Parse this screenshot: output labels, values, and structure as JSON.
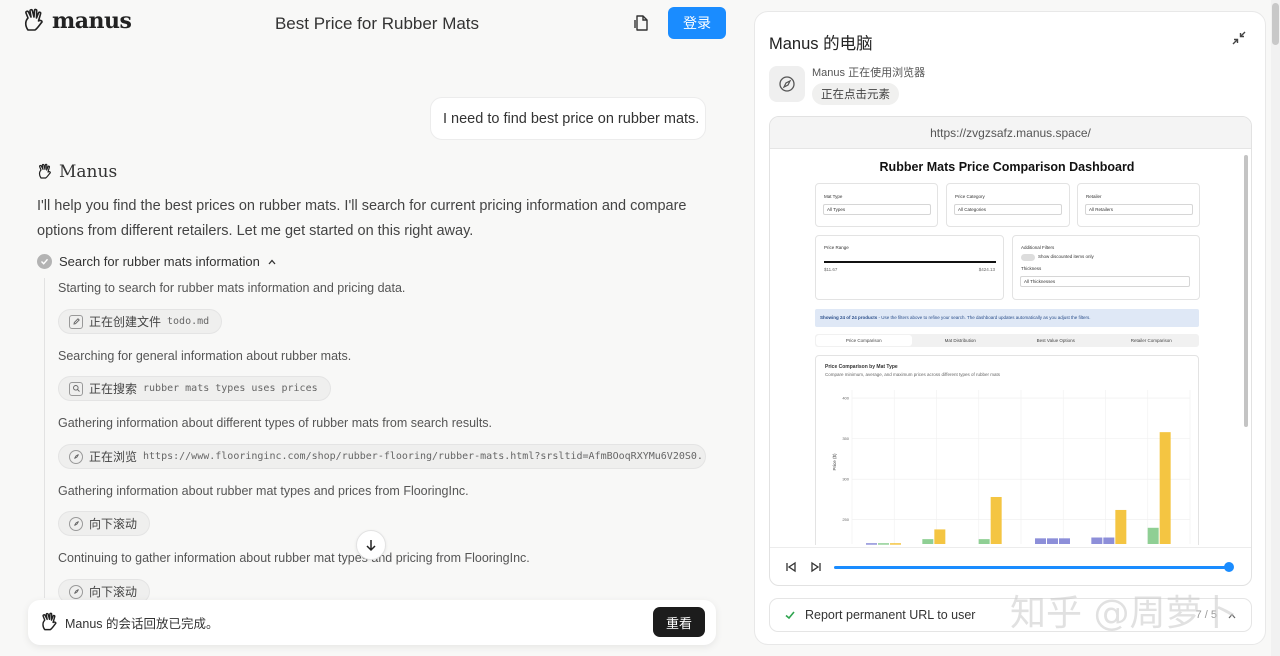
{
  "header": {
    "brand": "manus",
    "title": "Best Price for Rubber Mats",
    "login_label": "登录"
  },
  "chat": {
    "user_message": "I need to find best price on rubber mats.",
    "agent_name": "Manus",
    "agent_message": "I'll help you find the best prices on rubber mats. I'll search for current pricing information and compare options from different retailers. Let me get started on this right away.",
    "step_title": "Search for rubber mats information",
    "steps": [
      {
        "text": "Starting to search for rubber mats information and pricing data.",
        "action": "正在创建文件",
        "arg": "todo.md",
        "icon": "edit-icon"
      },
      {
        "text": "Searching for general information about rubber mats.",
        "action": "正在搜索",
        "arg": "rubber mats types uses prices",
        "icon": "search-icon"
      },
      {
        "text": "Gathering information about different types of rubber mats from search results.",
        "action": "正在浏览",
        "arg": "https://www.flooringinc.com/shop/rubber-flooring/rubber-mats.html?srsltid=AfmBOoqRXYMu6V20S0...",
        "icon": "compass-icon"
      },
      {
        "text": "Gathering information about rubber mat types and prices from FlooringInc.",
        "action": "向下滚动",
        "arg": "",
        "icon": "compass-icon"
      },
      {
        "text": "Continuing to gather information about rubber mat types and pricing from FlooringInc.",
        "action": "向下滚动",
        "arg": "",
        "icon": "compass-icon"
      }
    ],
    "completion_text": "Manus 的会话回放已完成。",
    "replay_label": "重看"
  },
  "computer": {
    "title": "Manus 的电脑",
    "using_text": "Manus 正在使用浏览器",
    "action": "正在点击元素",
    "url": "https://zvgzsafz.manus.space/",
    "status_text": "Report permanent URL to user",
    "counter": "7 / 5"
  },
  "dashboard": {
    "title": "Rubber Mats Price Comparison Dashboard",
    "filters": [
      {
        "label": "Mat Type",
        "value": "All Types"
      },
      {
        "label": "Price Category",
        "value": "All Categories"
      },
      {
        "label": "Retailer",
        "value": "All Retailers"
      }
    ],
    "price_range_label": "Price Range",
    "price_min": "$11.67",
    "price_max": "$424.13",
    "additional_filters_label": "Additional Filters",
    "discounted_label": "Show discounted items only",
    "thickness_label": "Thickness",
    "thickness_value": "All Thicknesses",
    "info_bold": "Showing 24 of 24 products",
    "info_rest": " - Use the filters above to refine your search. The dashboard updates automatically as you adjust the filters.",
    "tabs": [
      "Price Comparison",
      "Mat Distribution",
      "Best Value Options",
      "Retailer Comparison"
    ],
    "chart_title": "Price Comparison by Mat Type",
    "chart_subtitle": "Compare minimum, average, and maximum prices across different types of rubber mats",
    "chart_ylabel": "Price ($)"
  },
  "chart_data": {
    "type": "bar",
    "title": "Price Comparison by Mat Type",
    "ylabel": "Price ($)",
    "yticks": [
      "400",
      "350",
      "300",
      "250"
    ],
    "ylim": [
      220,
      410
    ],
    "series_colors": {
      "min": "#8d8fd9",
      "avg": "#8fcf94",
      "max": "#f4c542"
    },
    "groups": [
      {
        "bars": [
          {
            "s": "min",
            "v": 221
          },
          {
            "s": "avg",
            "v": 221
          },
          {
            "s": "max",
            "v": 221
          }
        ]
      },
      {
        "bars": [
          {
            "s": "avg",
            "v": 226
          },
          {
            "s": "max",
            "v": 238
          }
        ]
      },
      {
        "bars": [
          {
            "s": "avg",
            "v": 226
          },
          {
            "s": "max",
            "v": 278
          }
        ]
      },
      {
        "bars": [
          {
            "s": "min",
            "v": 227
          },
          {
            "s": "min",
            "v": 227
          },
          {
            "s": "min",
            "v": 227
          }
        ]
      },
      {
        "bars": [
          {
            "s": "min",
            "v": 228
          },
          {
            "s": "min",
            "v": 228
          },
          {
            "s": "max",
            "v": 262
          }
        ]
      },
      {
        "bars": [
          {
            "s": "avg",
            "v": 240
          },
          {
            "s": "max",
            "v": 358
          }
        ]
      }
    ]
  }
}
